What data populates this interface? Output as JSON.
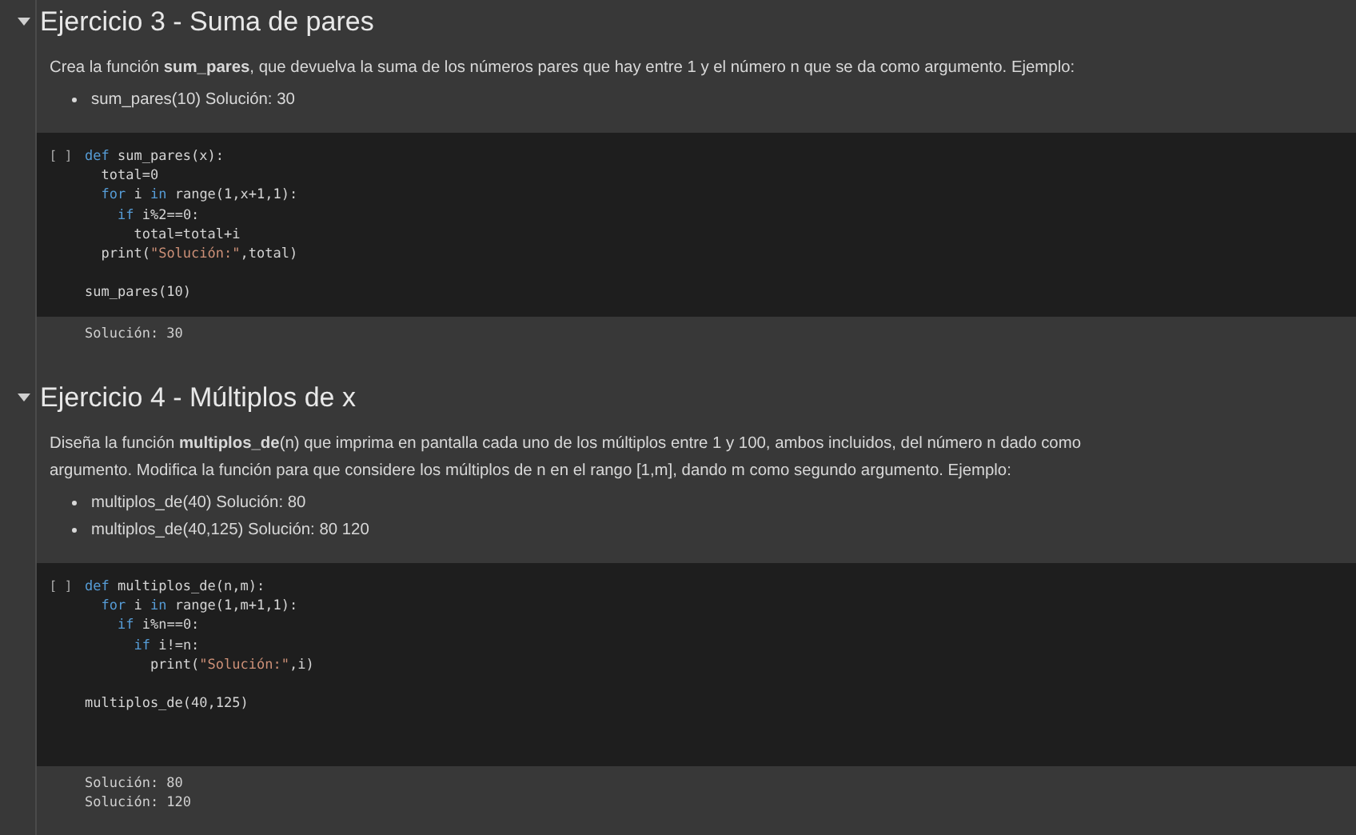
{
  "sections": [
    {
      "title": "Ejercicio 3 - Suma de pares",
      "expanded": true,
      "paragraph": "Crea la función **sum_pares**, que devuelva la suma de los números pares que hay entre 1 y el número n que se da como argumento. Ejemplo:",
      "bullets": [
        "sum_pares(10) Solución: 30"
      ],
      "cell": {
        "run_marker": "[ ]",
        "code": "def sum_pares(x):\n  total=0\n  for i in range(1,x+1,1):\n    if i%2==0:\n      total=total+i\n  print(\"Solución:\",total)\n\nsum_pares(10)",
        "output": [
          "Solución: 30"
        ]
      }
    },
    {
      "title": "Ejercicio 4 - Múltiplos de x",
      "expanded": true,
      "paragraph": "Diseña la función **multiplos_de**(n) que imprima en pantalla cada uno de los múltiplos entre 1 y 100, ambos incluidos, del número n dado como argumento. Modifica la función para que considere los múltiplos de n en el rango [1,m], dando m como segundo argumento. Ejemplo:",
      "bullets": [
        "multiplos_de(40) Solución: 80",
        "multiplos_de(40,125) Solución: 80 120"
      ],
      "cell": {
        "run_marker": "[ ]",
        "code": "def multiplos_de(n,m):\n  for i in range(1,m+1,1):\n    if i%n==0:\n      if i!=n:\n        print(\"Solución:\",i)\n\nmultiplos_de(40,125)\n\n",
        "output": [
          "Solución: 80",
          "Solución: 120"
        ]
      }
    }
  ]
}
